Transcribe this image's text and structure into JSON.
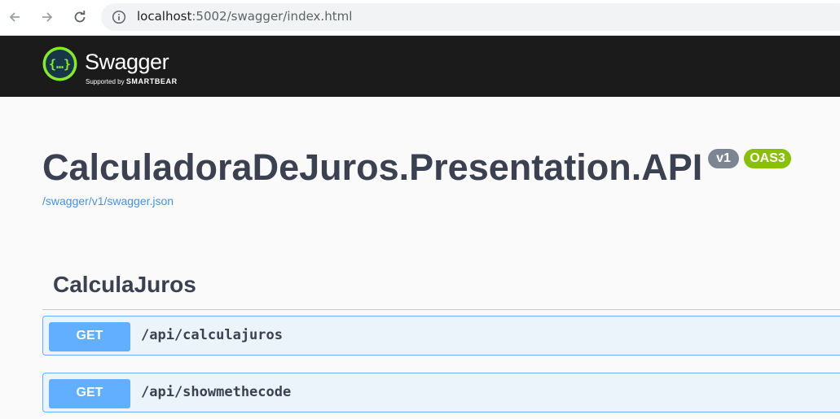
{
  "browser": {
    "url_host": "localhost",
    "url_rest": ":5002/swagger/index.html",
    "icons": [
      "back-arrow-icon",
      "forward-arrow-icon",
      "reload-icon",
      "info-icon"
    ]
  },
  "topbar": {
    "logo_text": "Swagger",
    "supported_by": "Supported by",
    "smartbear": "SMARTBEAR",
    "brand_color": "#85ea2d"
  },
  "info": {
    "title": "CalculadoraDeJuros.Presentation.API",
    "version_badge": "v1",
    "oas_badge": "OAS3",
    "spec_link": "/swagger/v1/swagger.json"
  },
  "tag": {
    "name": "CalculaJuros"
  },
  "operations": [
    {
      "method": "GET",
      "path": "/api/calculajuros"
    },
    {
      "method": "GET",
      "path": "/api/showmethecode"
    }
  ],
  "colors": {
    "get_method": "#61affe",
    "get_block_bg": "#ebf3fb",
    "title_text": "#3b4151",
    "oas_badge": "#89bf04",
    "version_badge": "#7d8492"
  }
}
